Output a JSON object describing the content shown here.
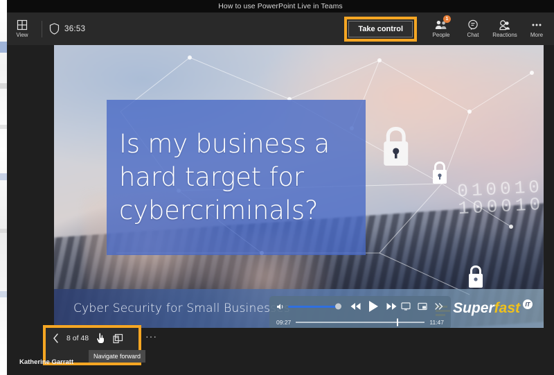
{
  "window": {
    "title": "How to use PowerPoint Live in Teams"
  },
  "toolbar": {
    "view_label": "View",
    "view_icon": "grid-view-icon",
    "shield_icon": "shield-icon",
    "timer": "36:53",
    "take_control_label": "Take control",
    "highlight_color": "#f5a623",
    "right_items": [
      {
        "label": "People",
        "icon": "people-icon",
        "badge": "1"
      },
      {
        "label": "Chat",
        "icon": "chat-icon",
        "badge": ""
      },
      {
        "label": "Reactions",
        "icon": "reactions-icon",
        "badge": ""
      },
      {
        "label": "More",
        "icon": "more-ellipsis-icon",
        "badge": ""
      }
    ]
  },
  "slide": {
    "title_line1": "Is my business a",
    "title_line2": "hard target for",
    "title_line3": "cybercriminals?",
    "title_block_color": "#4a6ac6",
    "caption": "Cyber Security for Small Businesses",
    "binary_line1": "010010",
    "binary_line2": "100010",
    "logo_super": "Super",
    "logo_fast": "fast",
    "logo_badge": "IT",
    "logo_accent": "#f0c11b",
    "lock_icon": "padlock-icon"
  },
  "player": {
    "volume_icon": "volume-icon",
    "rewind_icon": "rewind-icon",
    "play_icon": "play-icon",
    "forward_icon": "fast-forward-icon",
    "cast_icon": "cast-screen-icon",
    "pip_icon": "picture-in-picture-icon",
    "expand_icon": "double-chevron-right-icon",
    "elapsed": "09:27",
    "duration": "11:47"
  },
  "navbar": {
    "back_icon": "chevron-left-icon",
    "slide_counter": "8 of 48",
    "cursor_icon": "hand-cursor-icon",
    "layout_icon": "slide-layout-icon",
    "more_icon": "more-ellipsis-icon",
    "more_label": "···",
    "tooltip": "Navigate forward",
    "highlight_color": "#f5a623"
  },
  "presenter": {
    "name": "Katherine Garratt"
  }
}
